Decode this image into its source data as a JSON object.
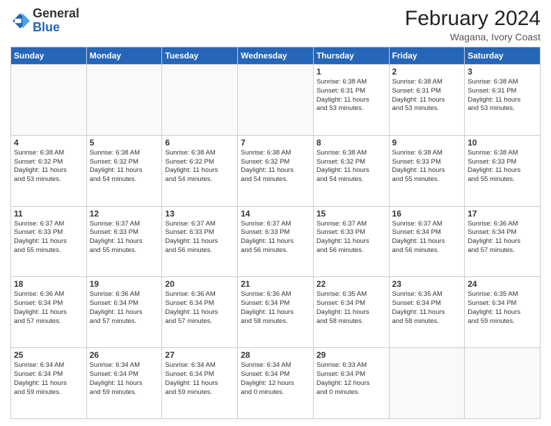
{
  "header": {
    "logo_general": "General",
    "logo_blue": "Blue",
    "month_year": "February 2024",
    "location": "Wagana, Ivory Coast"
  },
  "weekdays": [
    "Sunday",
    "Monday",
    "Tuesday",
    "Wednesday",
    "Thursday",
    "Friday",
    "Saturday"
  ],
  "weeks": [
    [
      {
        "day": "",
        "info": ""
      },
      {
        "day": "",
        "info": ""
      },
      {
        "day": "",
        "info": ""
      },
      {
        "day": "",
        "info": ""
      },
      {
        "day": "1",
        "info": "Sunrise: 6:38 AM\nSunset: 6:31 PM\nDaylight: 11 hours\nand 53 minutes."
      },
      {
        "day": "2",
        "info": "Sunrise: 6:38 AM\nSunset: 6:31 PM\nDaylight: 11 hours\nand 53 minutes."
      },
      {
        "day": "3",
        "info": "Sunrise: 6:38 AM\nSunset: 6:31 PM\nDaylight: 11 hours\nand 53 minutes."
      }
    ],
    [
      {
        "day": "4",
        "info": "Sunrise: 6:38 AM\nSunset: 6:32 PM\nDaylight: 11 hours\nand 53 minutes."
      },
      {
        "day": "5",
        "info": "Sunrise: 6:38 AM\nSunset: 6:32 PM\nDaylight: 11 hours\nand 54 minutes."
      },
      {
        "day": "6",
        "info": "Sunrise: 6:38 AM\nSunset: 6:32 PM\nDaylight: 11 hours\nand 54 minutes."
      },
      {
        "day": "7",
        "info": "Sunrise: 6:38 AM\nSunset: 6:32 PM\nDaylight: 11 hours\nand 54 minutes."
      },
      {
        "day": "8",
        "info": "Sunrise: 6:38 AM\nSunset: 6:32 PM\nDaylight: 11 hours\nand 54 minutes."
      },
      {
        "day": "9",
        "info": "Sunrise: 6:38 AM\nSunset: 6:33 PM\nDaylight: 11 hours\nand 55 minutes."
      },
      {
        "day": "10",
        "info": "Sunrise: 6:38 AM\nSunset: 6:33 PM\nDaylight: 11 hours\nand 55 minutes."
      }
    ],
    [
      {
        "day": "11",
        "info": "Sunrise: 6:37 AM\nSunset: 6:33 PM\nDaylight: 11 hours\nand 55 minutes."
      },
      {
        "day": "12",
        "info": "Sunrise: 6:37 AM\nSunset: 6:33 PM\nDaylight: 11 hours\nand 55 minutes."
      },
      {
        "day": "13",
        "info": "Sunrise: 6:37 AM\nSunset: 6:33 PM\nDaylight: 11 hours\nand 56 minutes."
      },
      {
        "day": "14",
        "info": "Sunrise: 6:37 AM\nSunset: 6:33 PM\nDaylight: 11 hours\nand 56 minutes."
      },
      {
        "day": "15",
        "info": "Sunrise: 6:37 AM\nSunset: 6:33 PM\nDaylight: 11 hours\nand 56 minutes."
      },
      {
        "day": "16",
        "info": "Sunrise: 6:37 AM\nSunset: 6:34 PM\nDaylight: 11 hours\nand 56 minutes."
      },
      {
        "day": "17",
        "info": "Sunrise: 6:36 AM\nSunset: 6:34 PM\nDaylight: 11 hours\nand 57 minutes."
      }
    ],
    [
      {
        "day": "18",
        "info": "Sunrise: 6:36 AM\nSunset: 6:34 PM\nDaylight: 11 hours\nand 57 minutes."
      },
      {
        "day": "19",
        "info": "Sunrise: 6:36 AM\nSunset: 6:34 PM\nDaylight: 11 hours\nand 57 minutes."
      },
      {
        "day": "20",
        "info": "Sunrise: 6:36 AM\nSunset: 6:34 PM\nDaylight: 11 hours\nand 57 minutes."
      },
      {
        "day": "21",
        "info": "Sunrise: 6:36 AM\nSunset: 6:34 PM\nDaylight: 11 hours\nand 58 minutes."
      },
      {
        "day": "22",
        "info": "Sunrise: 6:35 AM\nSunset: 6:34 PM\nDaylight: 11 hours\nand 58 minutes."
      },
      {
        "day": "23",
        "info": "Sunrise: 6:35 AM\nSunset: 6:34 PM\nDaylight: 11 hours\nand 58 minutes."
      },
      {
        "day": "24",
        "info": "Sunrise: 6:35 AM\nSunset: 6:34 PM\nDaylight: 11 hours\nand 59 minutes."
      }
    ],
    [
      {
        "day": "25",
        "info": "Sunrise: 6:34 AM\nSunset: 6:34 PM\nDaylight: 11 hours\nand 59 minutes."
      },
      {
        "day": "26",
        "info": "Sunrise: 6:34 AM\nSunset: 6:34 PM\nDaylight: 11 hours\nand 59 minutes."
      },
      {
        "day": "27",
        "info": "Sunrise: 6:34 AM\nSunset: 6:34 PM\nDaylight: 11 hours\nand 59 minutes."
      },
      {
        "day": "28",
        "info": "Sunrise: 6:34 AM\nSunset: 6:34 PM\nDaylight: 12 hours\nand 0 minutes."
      },
      {
        "day": "29",
        "info": "Sunrise: 6:33 AM\nSunset: 6:34 PM\nDaylight: 12 hours\nand 0 minutes."
      },
      {
        "day": "",
        "info": ""
      },
      {
        "day": "",
        "info": ""
      }
    ]
  ]
}
